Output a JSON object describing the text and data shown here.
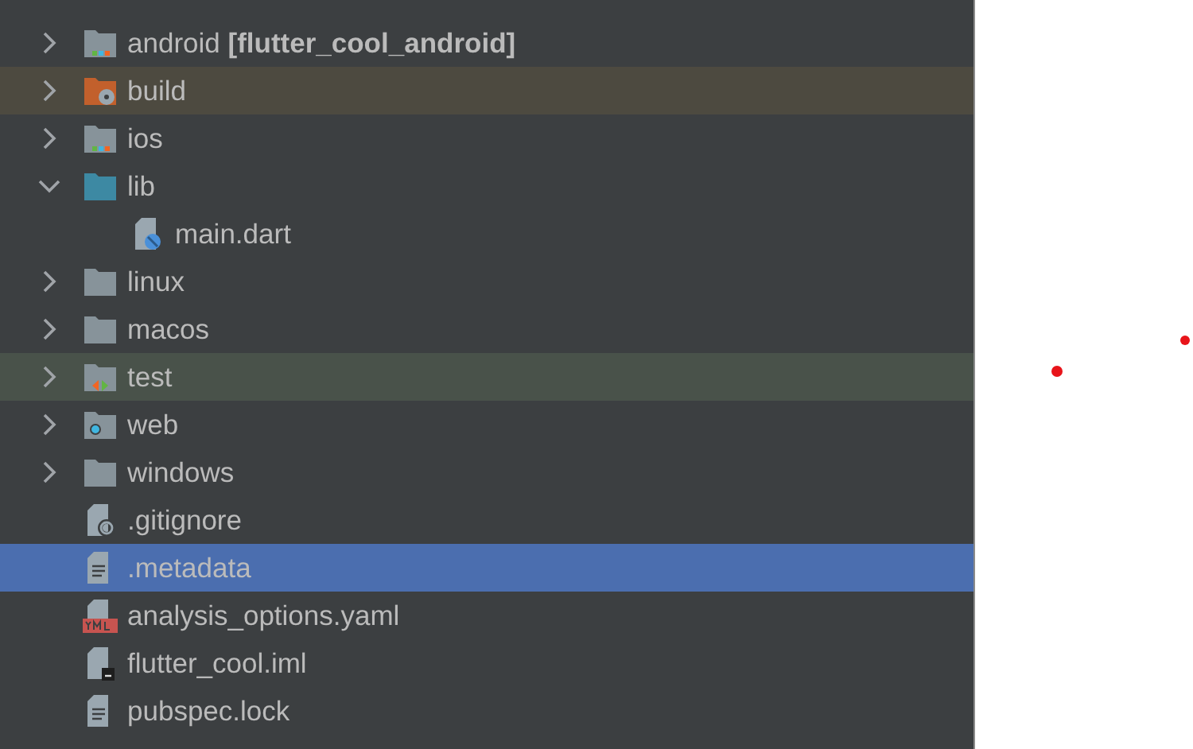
{
  "tree": [
    {
      "label": "android **[flutter_cool_android]**",
      "kind": "folder-module",
      "expanded": false,
      "selected": false
    },
    {
      "label": "build",
      "kind": "folder-excluded",
      "expanded": false,
      "selected": false
    },
    {
      "label": "ios",
      "kind": "folder-module",
      "expanded": false,
      "selected": false
    },
    {
      "label": "lib",
      "kind": "folder-source",
      "expanded": true,
      "selected": false,
      "children": [
        {
          "label": "main.dart",
          "kind": "file-dart",
          "selected": false
        }
      ]
    },
    {
      "label": "linux",
      "kind": "folder",
      "expanded": false,
      "selected": false
    },
    {
      "label": "macos",
      "kind": "folder",
      "expanded": false,
      "selected": false
    },
    {
      "label": "test",
      "kind": "folder-test",
      "expanded": false,
      "selected": false
    },
    {
      "label": "web",
      "kind": "folder-web",
      "expanded": false,
      "selected": false
    },
    {
      "label": "windows",
      "kind": "folder",
      "expanded": false,
      "selected": false
    },
    {
      "label": ".gitignore",
      "kind": "file-ignore",
      "selected": false
    },
    {
      "label": ".metadata",
      "kind": "file-text",
      "selected": true
    },
    {
      "label": "analysis_options.yaml",
      "kind": "file-yaml",
      "selected": false
    },
    {
      "label": "flutter_cool.iml",
      "kind": "file-iml",
      "selected": false
    },
    {
      "label": "pubspec.lock",
      "kind": "file-text",
      "selected": false
    }
  ]
}
